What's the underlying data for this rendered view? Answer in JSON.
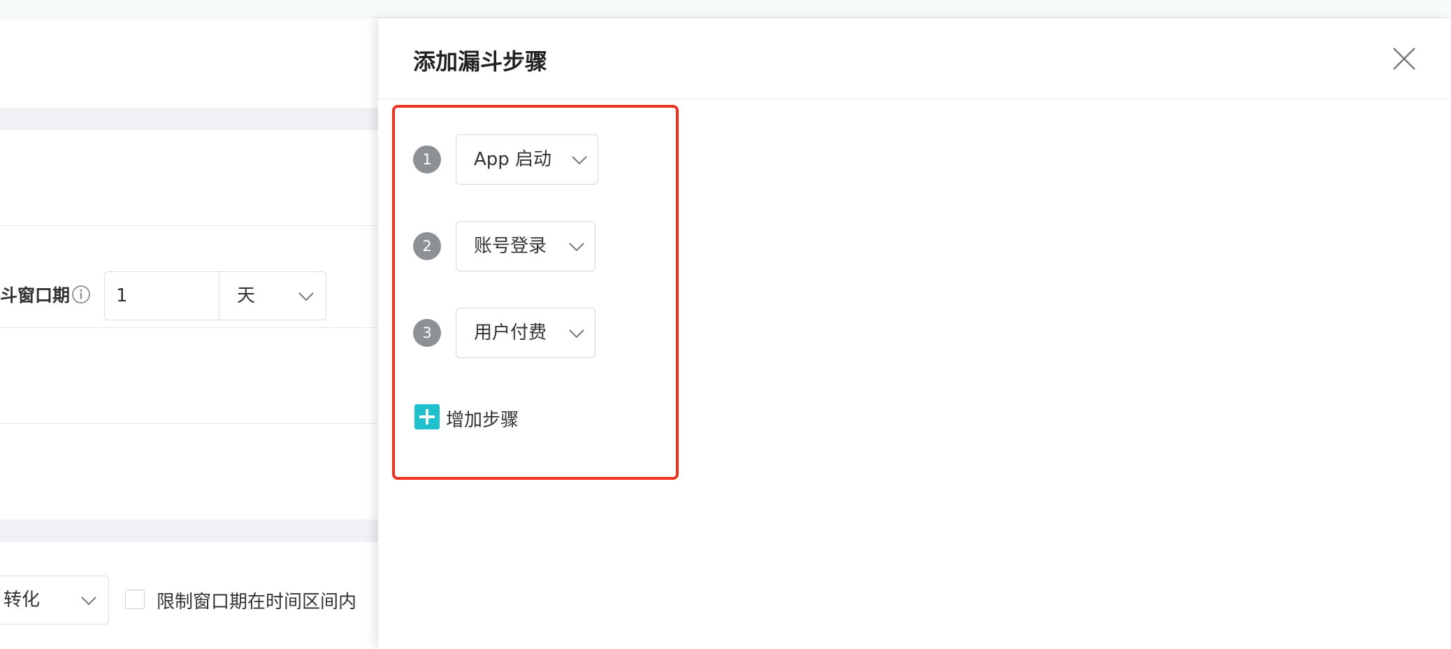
{
  "left_form": {
    "window_label": "斗窗口期",
    "window_value": "1",
    "window_unit": "天",
    "conversion_select": "转化",
    "limit_label": "限制窗口期在时间区间内"
  },
  "drawer": {
    "title": "添加漏斗步骤",
    "steps": [
      {
        "number": "1",
        "label": "App 启动"
      },
      {
        "number": "2",
        "label": "账号登录"
      },
      {
        "number": "3",
        "label": "用户付费"
      }
    ],
    "add_step_label": "增加步骤"
  },
  "colors": {
    "highlight_border": "#f0301f",
    "add_icon": "#1fc2cc",
    "step_badge": "#8d9196"
  },
  "icons": {
    "close": "close-icon",
    "info": "info-icon",
    "dropdown": "chevron-down-icon",
    "add": "plus-square-icon"
  }
}
